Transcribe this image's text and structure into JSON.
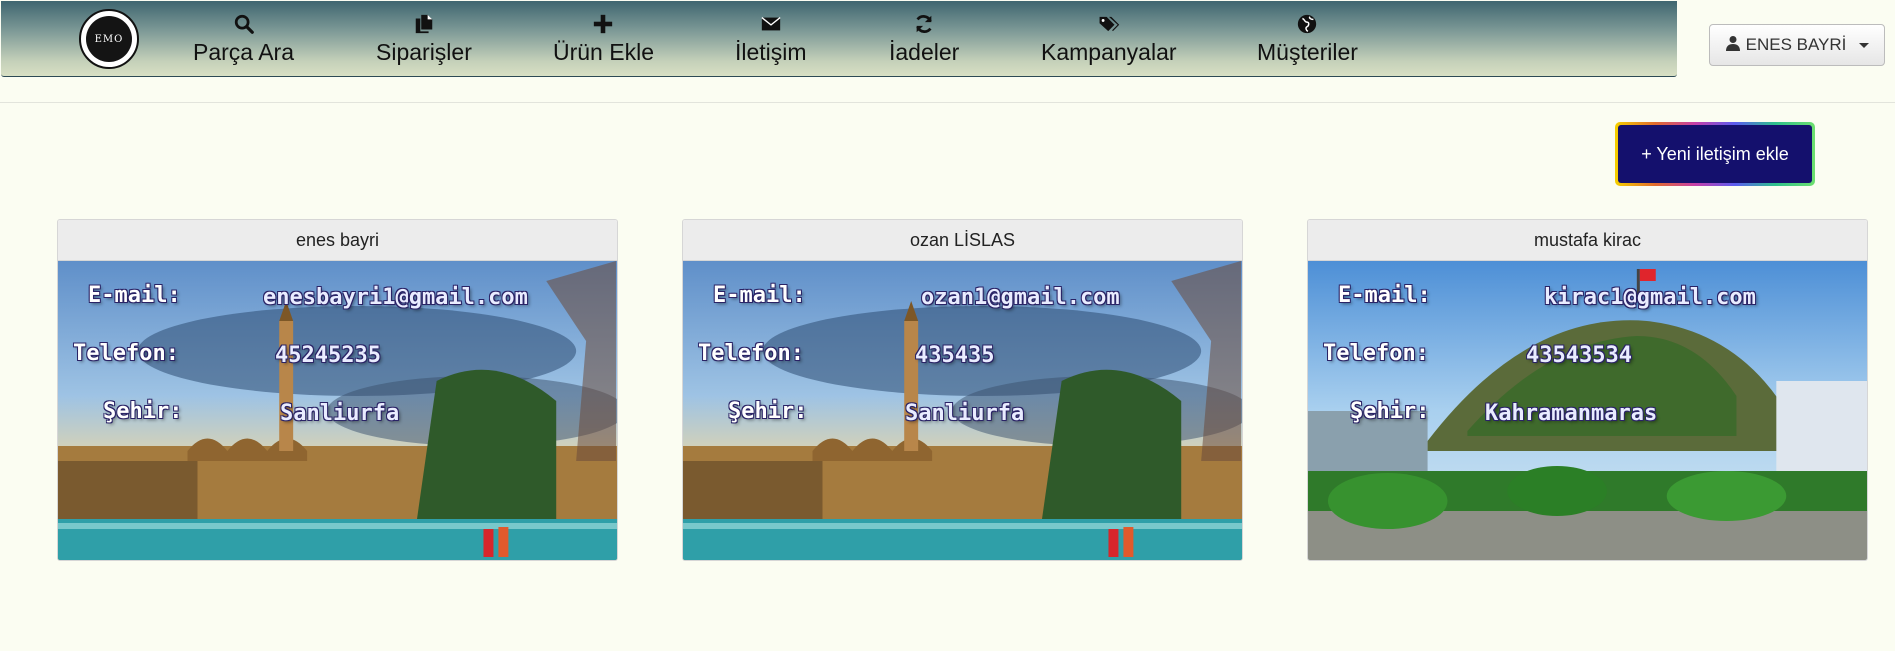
{
  "nav": {
    "logo_text": "EMO",
    "items": [
      {
        "label": "Parça Ara",
        "icon": "search-icon"
      },
      {
        "label": "Siparişler",
        "icon": "documents-icon"
      },
      {
        "label": "Ürün Ekle",
        "icon": "plus-icon"
      },
      {
        "label": "İletişim",
        "icon": "envelope-icon"
      },
      {
        "label": "İadeler",
        "icon": "refresh-icon"
      },
      {
        "label": "Kampanyalar",
        "icon": "tags-icon"
      },
      {
        "label": "Müşteriler",
        "icon": "globe-icon"
      }
    ],
    "user": {
      "name": "ENES BAYRİ",
      "icon": "user-icon"
    }
  },
  "actions": {
    "add_contact": "+ Yeni iletişim ekle"
  },
  "labels": {
    "email": "E-mail:",
    "phone": "Telefon:",
    "city": "Şehir:"
  },
  "contacts": [
    {
      "name": "enes bayri",
      "email": "enesbayri1@gmail.com",
      "phone": "45245235",
      "city": "Sanliurfa"
    },
    {
      "name": "ozan LİSLAS",
      "email": "ozan1@gmail.com",
      "phone": "435435",
      "city": "Sanliurfa"
    },
    {
      "name": "mustafa kirac",
      "email": "kirac1@gmail.com",
      "phone": "43543534",
      "city": "Kahramanmaras"
    }
  ],
  "colors": {
    "add_button_bg": "#14106d",
    "page_bg": "#fbfdf2",
    "nav_top": "#3f6670",
    "nav_bottom": "#d8e0c4"
  }
}
